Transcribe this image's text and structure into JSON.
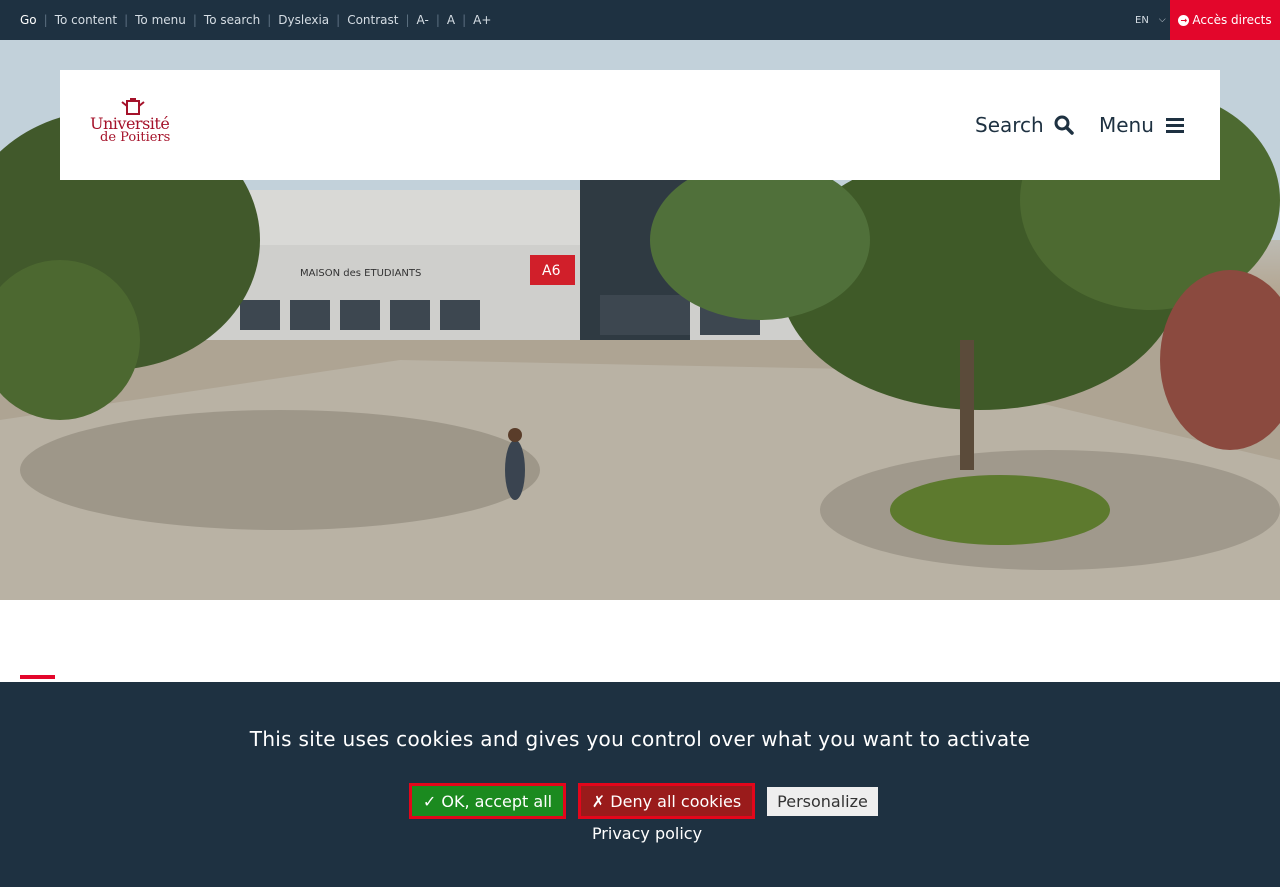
{
  "topbar": {
    "links": [
      {
        "label": "Go"
      },
      {
        "label": "To content"
      },
      {
        "label": "To menu"
      },
      {
        "label": "To search"
      },
      {
        "label": "Dyslexia"
      },
      {
        "label": "Contrast"
      },
      {
        "label": "A-"
      },
      {
        "label": "A"
      },
      {
        "label": "A+"
      }
    ],
    "language": "EN",
    "quick_access": "Accès directs"
  },
  "header": {
    "logo_text_line1": "Université",
    "logo_text_line2": "de Poitiers",
    "search_label": "Search",
    "menu_label": "Menu"
  },
  "hero": {
    "sign_text": "MAISON des ETUDIANTS",
    "building_code": "A6"
  },
  "cookie_banner": {
    "message": "This site uses cookies and gives you control over what you want to activate",
    "accept_label": "✓ OK, accept all",
    "deny_label": "✗ Deny all cookies",
    "personalize_label": "Personalize",
    "privacy_label": "Privacy policy"
  },
  "colors": {
    "topbar_bg": "#1e3141",
    "accent_red": "#e3062b",
    "accept_green": "#1b8a1f",
    "deny_red": "#9a1b1b",
    "logo_red": "#a5122a"
  }
}
